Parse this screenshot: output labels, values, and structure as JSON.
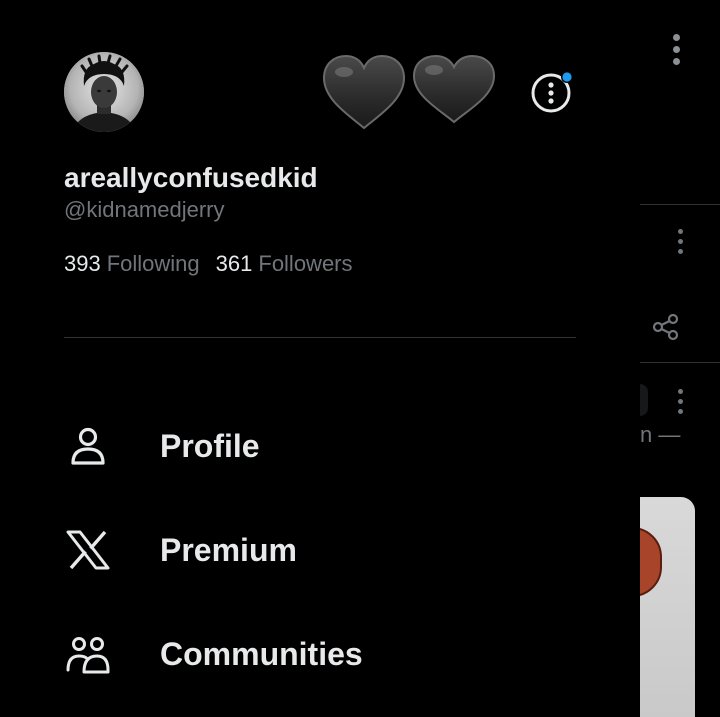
{
  "profile": {
    "display_name": "areallyconfusedkid",
    "handle": "@kidnamedjerry",
    "following_count": "393",
    "following_label": "Following",
    "followers_count": "361",
    "followers_label": "Followers"
  },
  "header": {
    "badges": [
      "black-heart-icon",
      "black-heart-icon"
    ],
    "more_icon": "more-circle-icon",
    "notification_dot_color": "#1d9bf0"
  },
  "nav": {
    "items": [
      {
        "label": "Profile",
        "icon": "person-icon"
      },
      {
        "label": "Premium",
        "icon": "x-logo-icon"
      },
      {
        "label": "Communities",
        "icon": "communities-icon"
      }
    ]
  },
  "background": {
    "partial_text": "n —"
  },
  "colors": {
    "background": "#000000",
    "primary_text": "#e7e9ea",
    "secondary_text": "#71767b",
    "divider": "#2f3336",
    "accent": "#1d9bf0"
  }
}
